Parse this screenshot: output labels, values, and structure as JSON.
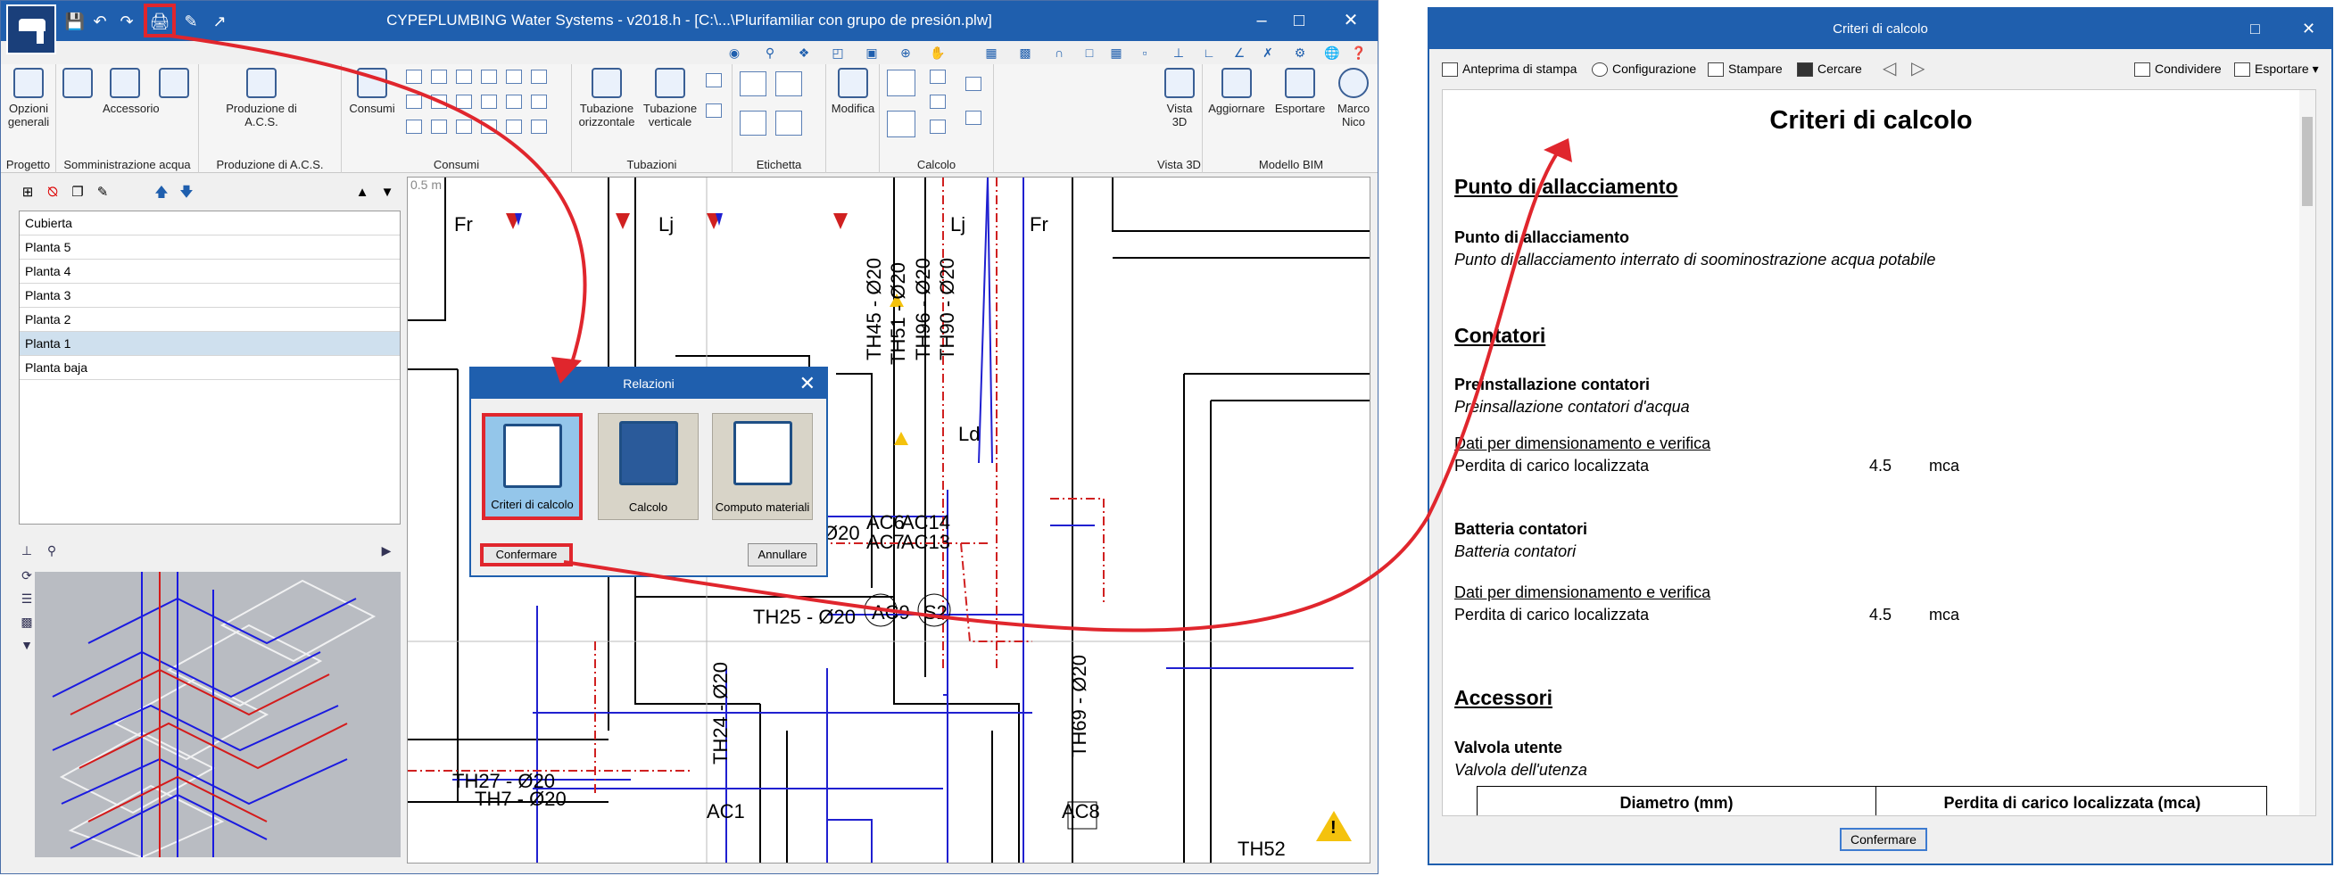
{
  "app": {
    "title": "CYPEPLUMBING Water Systems - v2018.h - [C:\\...\\Plurifamiliar con grupo de presión.plw]",
    "ribbon": {
      "opzioni_generali": "Opzioni generali",
      "accessorio": "Accessorio",
      "produzione_acs": "Produzione di A.C.S.",
      "consumi_btn": "Consumi",
      "tubazione_orizzontale": "Tubazione orizzontale",
      "tubazione_verticale": "Tubazione verticale",
      "modifica": "Modifica",
      "vista_3d": "Vista 3D",
      "aggiornare": "Aggiornare",
      "esportare": "Esportare",
      "marco_nico": "Marco Nico",
      "groups": [
        "Progetto",
        "Somministrazione acqua",
        "Produzione di A.C.S.",
        "Consumi",
        "Tubazioni",
        "Etichetta",
        "Calcolo",
        "Vista 3D",
        "Modello BIM"
      ]
    },
    "floors": [
      "Cubierta",
      "Planta 5",
      "Planta 4",
      "Planta 3",
      "Planta 2",
      "Planta 1",
      "Planta baja"
    ],
    "selected_floor": "Planta 1",
    "drawing": {
      "scale": "0.5 m",
      "labels": {
        "fr1": "Fr",
        "lj1": "Lj",
        "lj2": "Lj",
        "fr2": "Fr",
        "th45": "TH45 - Ø20",
        "th51": "TH51 - Ø20",
        "th96": "TH96 - Ø20",
        "th90": "TH90 - Ø20",
        "ld": "Ld",
        "o20a": "Ø20",
        "ac6": "AC6",
        "ac14": "AC14",
        "ac7": "AC7",
        "ac13": "AC13",
        "th25": "TH25 - Ø20",
        "acs": "AC9",
        "s2": "S2",
        "th24": "TH24 - Ø20",
        "th69": "TH69 - Ø20",
        "th27": "TH27 - Ø20",
        "th7": "TH7 - Ø20",
        "ac1": "AC1",
        "ac8": "AC8",
        "th52": "TH52"
      }
    }
  },
  "dialog": {
    "title": "Relazioni",
    "options": [
      "Criteri di calcolo",
      "Calcolo",
      "Computo materiali"
    ],
    "confirm": "Confermare",
    "cancel": "Annullare"
  },
  "report": {
    "window_title": "Criteri di calcolo",
    "toolbar": {
      "preview": "Anteprima di stampa",
      "config": "Configurazione",
      "print": "Stampare",
      "search": "Cercare",
      "share": "Condividere",
      "export": "Esportare"
    },
    "heading": "Criteri di calcolo",
    "sections": {
      "allacciamento": {
        "title": "Punto di allacciamento",
        "sub": "Punto di allacciamento",
        "desc": "Punto di allacciamento interrato di soominostrazione acqua potabile"
      },
      "contatori": {
        "title": "Contatori",
        "sub1": "Preinstallazione contatori",
        "desc1": "Preinsallazione contatori d'acqua",
        "link1": "Dati per dimensionamento e verifica",
        "row1_label": "Perdita di carico localizzata",
        "row1_value": "4.5",
        "row1_unit": "mca",
        "sub2": "Batteria contatori",
        "desc2": "Batteria contatori",
        "link2": "Dati per dimensionamento e verifica",
        "row2_label": "Perdita di carico localizzata",
        "row2_value": "4.5",
        "row2_unit": "mca"
      },
      "accessori": {
        "title": "Accessori",
        "sub": "Valvola utente",
        "desc": "Valvola dell'utenza",
        "table_headers": [
          "Diametro (mm)",
          "Perdita di carico localizzata (mca)"
        ]
      }
    },
    "confirm": "Confermare"
  },
  "colors": {
    "titlebar": "#1f5fae",
    "highlight": "#e0262d",
    "pipe_blue": "#2020d0",
    "pipe_red": "#d02020"
  }
}
